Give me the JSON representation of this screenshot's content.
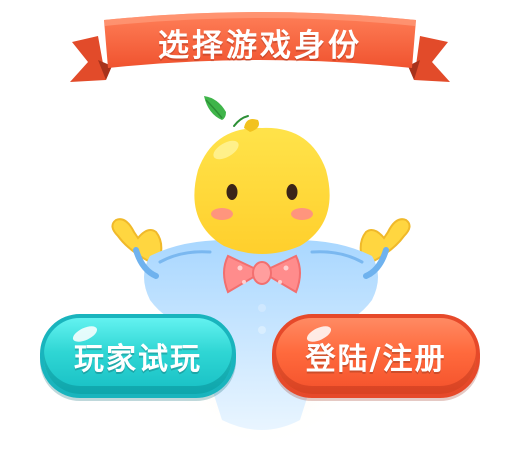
{
  "title": "选择游戏身份",
  "buttons": {
    "trial_label": "玩家试玩",
    "login_label": "登陆/注册"
  },
  "mascot": {
    "icon": "lemon-mascot-icon"
  },
  "colors": {
    "banner": "#ff6a3d",
    "banner_fold": "#c63b1f",
    "trial_button": "#2fd6d4",
    "login_button": "#ff6a3d",
    "mascot_body": "#ffd83a",
    "mascot_suit": "#8ec9ff",
    "bow_tie": "#ff8a8a"
  }
}
